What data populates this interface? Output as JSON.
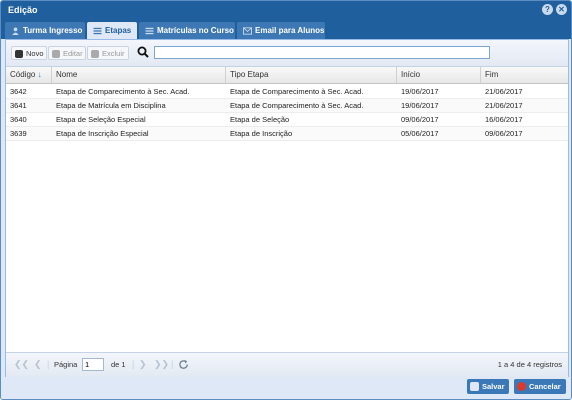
{
  "window": {
    "title": "Edição"
  },
  "tabs": [
    {
      "label": "Turma Ingresso",
      "icon": "user-icon",
      "active": false
    },
    {
      "label": "Etapas",
      "icon": "list-icon",
      "active": true
    },
    {
      "label": "Matrículas no Curso",
      "icon": "list-icon",
      "active": false
    },
    {
      "label": "Email para Alunos",
      "icon": "envelope-icon",
      "active": false
    }
  ],
  "toolbar": {
    "new_label": "Novo",
    "edit_label": "Editar",
    "delete_label": "Excluir",
    "search_value": ""
  },
  "grid": {
    "columns": [
      "Código",
      "Nome",
      "Tipo Etapa",
      "Início",
      "Fim"
    ],
    "sort_indicator": "↓",
    "rows": [
      [
        "3642",
        "Etapa de Comparecimento à Sec. Acad.",
        "Etapa de Comparecimento à Sec. Acad.",
        "19/06/2017",
        "21/06/2017"
      ],
      [
        "3641",
        "Etapa de Matrícula em Disciplina",
        "Etapa de Comparecimento à Sec. Acad.",
        "19/06/2017",
        "21/06/2017"
      ],
      [
        "3640",
        "Etapa de Seleção Especial",
        "Etapa de Seleção",
        "09/06/2017",
        "16/06/2017"
      ],
      [
        "3639",
        "Etapa de Inscrição Especial",
        "Etapa de Inscrição",
        "05/06/2017",
        "09/06/2017"
      ]
    ]
  },
  "pager": {
    "page_label": "Página",
    "page_value": "1",
    "of_label": "de 1",
    "summary": "1 a 4 de 4 registros"
  },
  "footer": {
    "save_label": "Salvar",
    "cancel_label": "Cancelar"
  },
  "colors": {
    "header_blue": "#1f5f9d",
    "save_green": "#3b78b8",
    "cancel_red": "#3b78b8"
  }
}
